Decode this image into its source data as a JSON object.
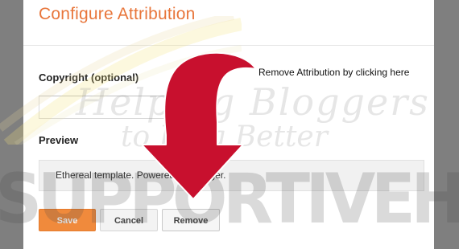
{
  "dialog": {
    "title": "Configure Attribution",
    "copyright_label": "Copyright (optional)",
    "copyright_value": "",
    "preview_label": "Preview",
    "preview_text": "Ethereal template. Powered by Blogger.",
    "buttons": {
      "save": "Save",
      "cancel": "Cancel",
      "remove": "Remove"
    }
  },
  "overlay": {
    "annotation": "Remove Attribution by clicking here",
    "arrow_color": "#c8102e",
    "watermark_script_line1": "Helping Bloggers",
    "watermark_script_line2": "to Blog Better",
    "watermark_brand": "SUPPORTIVEHANDS"
  },
  "colors": {
    "title": "#e8763b",
    "save_button": "#f08a3c",
    "backdrop": "#7f7f7f"
  }
}
